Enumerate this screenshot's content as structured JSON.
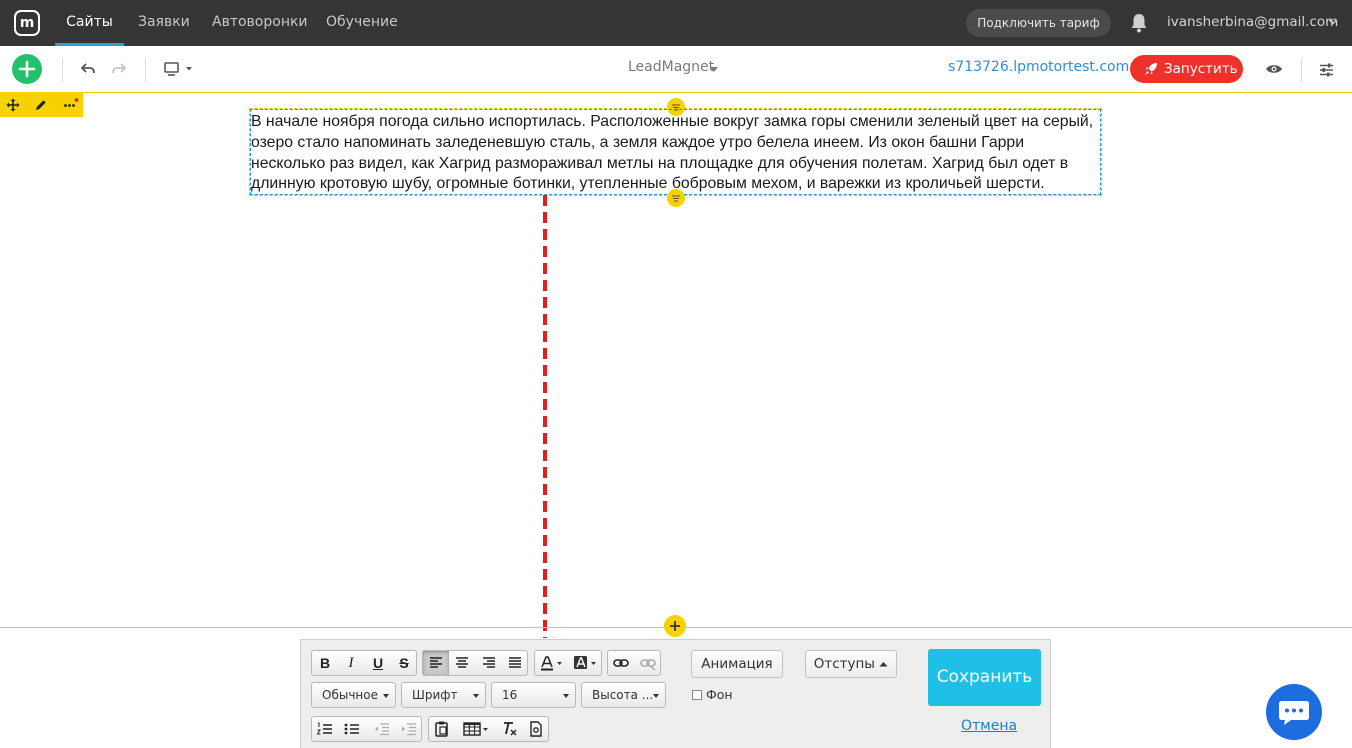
{
  "topnav": {
    "logo": "m",
    "tabs": [
      {
        "label": "Сайты",
        "active": true
      },
      {
        "label": "Заявки",
        "active": false
      },
      {
        "label": "Автоворонки",
        "active": false
      },
      {
        "label": "Обучение",
        "active": false
      }
    ],
    "plan_button": "Подключить тариф",
    "user_email": "ivansherbina@gmail.com"
  },
  "editor_toolbar": {
    "site_name": "LeadMagnet",
    "site_url": "s713726.lpmotortest.com",
    "launch_label": "Запустить"
  },
  "canvas": {
    "text_block": "В начале ноября погода сильно испортилась. Расположенные вокруг замка горы сменили зеленый цвет на серый, озеро стало напоминать заледеневшую сталь, а земля каждое утро белела инеем. Из окон башни Гарри несколько раз видел, как Хагрид размораживал метлы на площадке для обучения полетам. Хагрид был одет в длинную кротовую шубу, огромные ботинки, утепленные бобровым мехом, и варежки из кроличьей шерсти."
  },
  "format_panel": {
    "bold": "B",
    "italic": "I",
    "underline": "U",
    "strike": "S",
    "style_select": "Обычное",
    "font_select": "Шрифт",
    "size_select": "16",
    "line_height_select": "Высота ...",
    "animation_button": "Анимация",
    "padding_button": "Отступы",
    "background_checkbox": "Фон",
    "save_button": "Сохранить",
    "cancel_link": "Отмена"
  },
  "colors": {
    "topnav_bg": "#353535",
    "accent_blue": "#2e9bdf",
    "add_green": "#23c16b",
    "launch_red": "#f0302a",
    "selection_yellow": "#f5d200",
    "save_cyan": "#1fc0e8",
    "chat_blue": "#1e6de0"
  }
}
